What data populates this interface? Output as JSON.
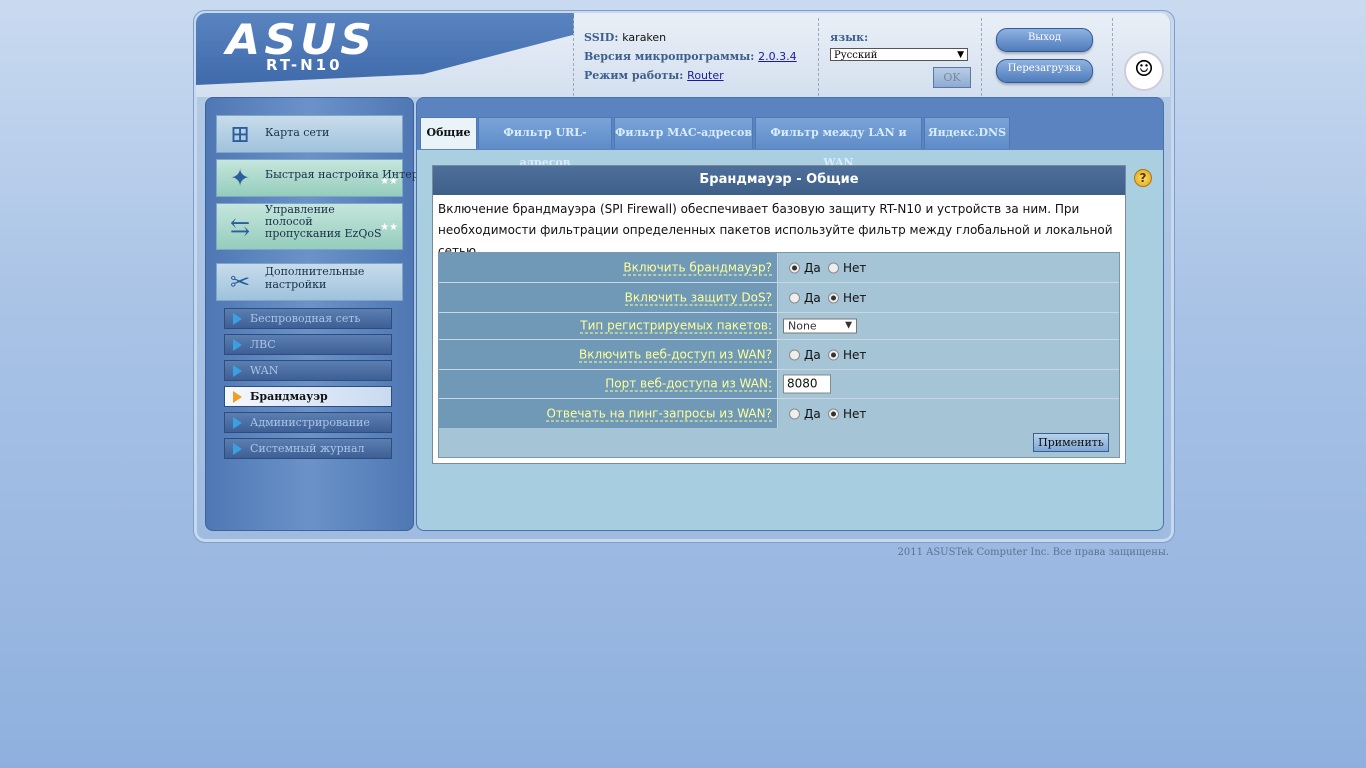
{
  "header": {
    "logo": "ASUS",
    "model": "RT-N10",
    "ssid_label": "SSID:",
    "ssid_value": "karaken",
    "firmware_label": "Версия микропрограммы:",
    "firmware_value": "2.0.3.4",
    "mode_label": "Режим работы:",
    "mode_value": "Router",
    "lang_label": "язык:",
    "lang_value": "Русский",
    "ok_label": "OK",
    "logout_label": "Выход",
    "reboot_label": "Перезагрузка"
  },
  "sidebar": {
    "main_items": [
      {
        "label": "Карта сети",
        "icon": "network-map-icon"
      },
      {
        "label": "Быстрая настройка Интернет",
        "icon": "magic-wand-icon"
      },
      {
        "label": "Управление полосой пропускания EzQoS",
        "line1": "Управление",
        "line2": "полосой",
        "line3": "пропускания EzQoS",
        "icon": "qos-icon"
      },
      {
        "label": "Дополнительные настройки",
        "icon": "tools-icon"
      }
    ],
    "sub_items": [
      {
        "label": "Беспроводная сеть"
      },
      {
        "label": "ЛВС"
      },
      {
        "label": "WAN"
      },
      {
        "label": "Брандмауэр",
        "active": true
      },
      {
        "label": "Администрирование"
      },
      {
        "label": "Системный журнал"
      }
    ]
  },
  "tabs": [
    {
      "label": "Общие",
      "active": true
    },
    {
      "label": "Фильтр URL-адресов"
    },
    {
      "label": "Фильтр MAC-адресов"
    },
    {
      "label": "Фильтр между LAN и WAN"
    },
    {
      "label": "Яндекс.DNS"
    }
  ],
  "panel": {
    "title": "Брандмауэр - Общие",
    "description": "Включение брандмауэра (SPI Firewall) обеспечивает базовую защиту RT-N10 и устройств за ним. При необходимости фильтрации определенных пакетов используйте фильтр между глобальной и локальной сетью.",
    "yes": "Да",
    "no": "Нет",
    "fields": {
      "firewall": {
        "label": "Включить брандмауэр?",
        "value": "Да"
      },
      "dos": {
        "label": "Включить защиту DoS?",
        "value": "Нет"
      },
      "log_type": {
        "label": "Тип регистрируемых пакетов:",
        "value": "None"
      },
      "wan_web": {
        "label": "Включить веб-доступ из WAN?",
        "value": "Нет"
      },
      "wan_port": {
        "label": "Порт веб-доступа из WAN:",
        "value": "8080"
      },
      "ping": {
        "label": "Отвечать на пинг-запросы из WAN?",
        "value": "Нет"
      }
    },
    "apply_label": "Применить"
  },
  "footer": {
    "copyright": "2011 ASUSTek Computer Inc. Все права защищены."
  },
  "colors": {
    "accent": "#3e5f88",
    "label_text": "#ffff9a"
  }
}
